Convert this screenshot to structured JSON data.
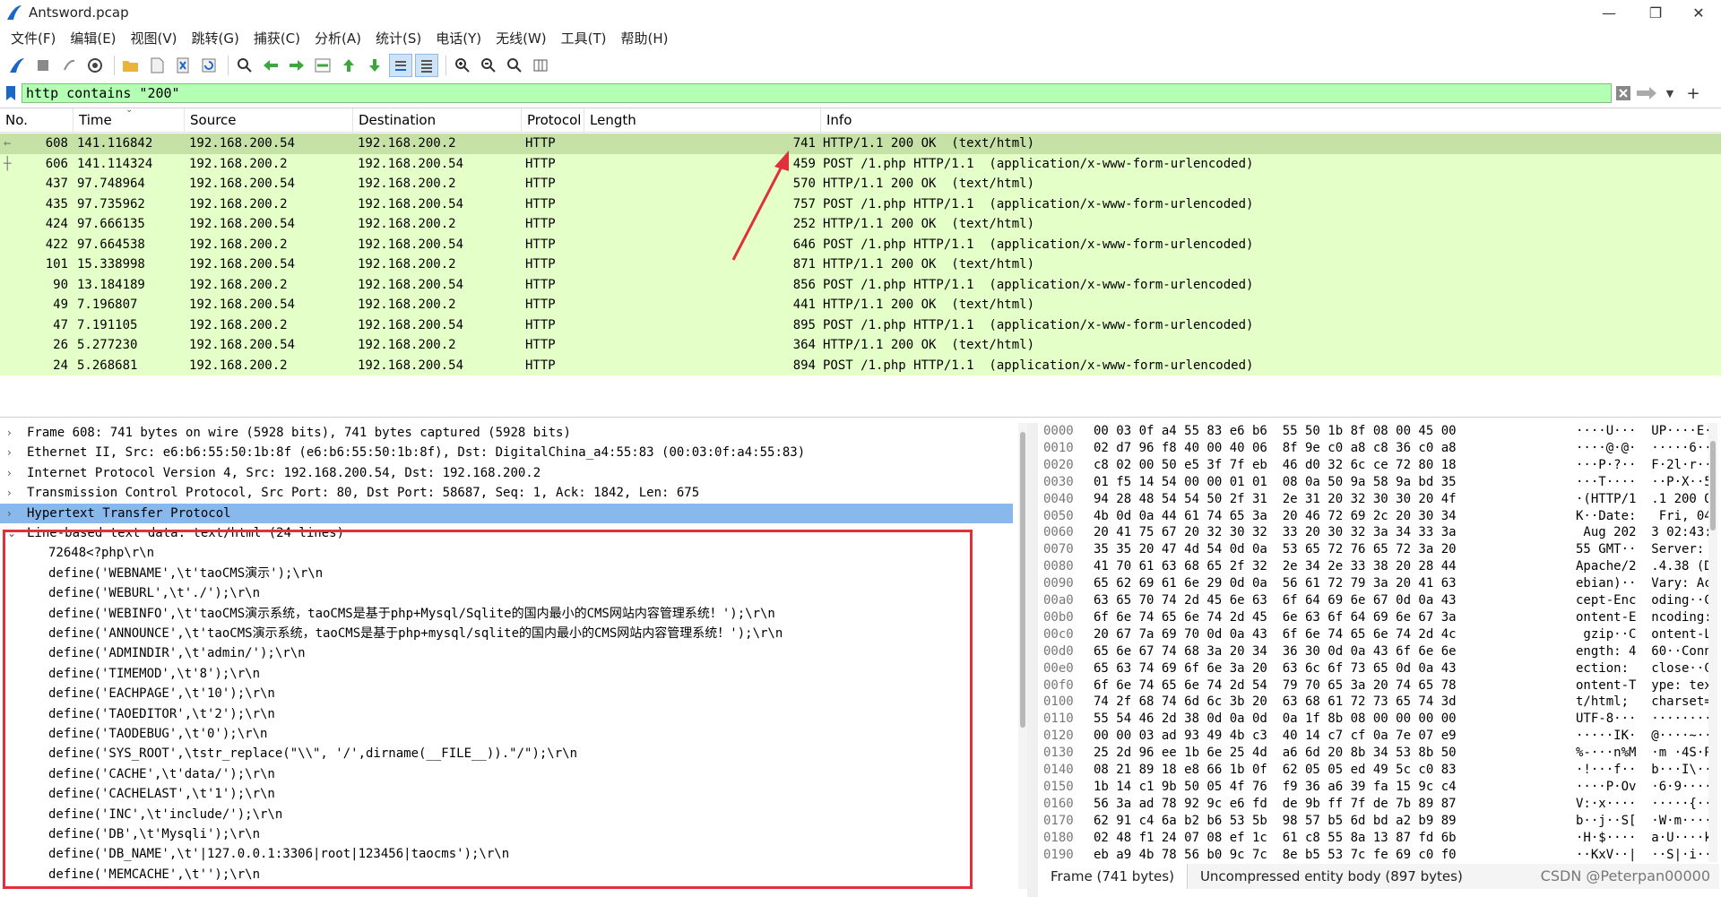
{
  "window": {
    "title": "Antsword.pcap"
  },
  "menu": [
    "文件(F)",
    "编辑(E)",
    "视图(V)",
    "跳转(G)",
    "捕获(C)",
    "分析(A)",
    "统计(S)",
    "电话(Y)",
    "无线(W)",
    "工具(T)",
    "帮助(H)"
  ],
  "toolbar": {
    "icons": [
      "shark-start-icon",
      "stop-icon",
      "restart-icon",
      "options-icon",
      "open-file-icon",
      "file-icon",
      "close-file-icon",
      "reload-icon",
      "find-icon",
      "go-back-icon",
      "go-forward-icon",
      "go-to-packet-icon",
      "first-packet-icon",
      "last-packet-icon",
      "autoscroll-icon",
      "colorize-icon",
      "zoom-in-icon",
      "zoom-out-icon",
      "zoom-reset-icon",
      "resize-columns-icon"
    ]
  },
  "filter": {
    "value": "http contains \"200\"",
    "bg_color": "#b3ffb3"
  },
  "packet_list": {
    "columns": [
      "No.",
      "Time",
      "Source",
      "Destination",
      "Protocol",
      "Length",
      "Info"
    ],
    "rows": [
      {
        "no": "608",
        "time": "141.116842",
        "src": "192.168.200.54",
        "dst": "192.168.200.2",
        "proto": "HTTP",
        "len": "741",
        "info": "HTTP/1.1 200 OK  (text/html)",
        "selected": true
      },
      {
        "no": "606",
        "time": "141.114324",
        "src": "192.168.200.2",
        "dst": "192.168.200.54",
        "proto": "HTTP",
        "len": "459",
        "info": "POST /1.php HTTP/1.1  (application/x-www-form-urlencoded)"
      },
      {
        "no": "437",
        "time": "97.748964",
        "src": "192.168.200.54",
        "dst": "192.168.200.2",
        "proto": "HTTP",
        "len": "570",
        "info": "HTTP/1.1 200 OK  (text/html)"
      },
      {
        "no": "435",
        "time": "97.735962",
        "src": "192.168.200.2",
        "dst": "192.168.200.54",
        "proto": "HTTP",
        "len": "757",
        "info": "POST /1.php HTTP/1.1  (application/x-www-form-urlencoded)"
      },
      {
        "no": "424",
        "time": "97.666135",
        "src": "192.168.200.54",
        "dst": "192.168.200.2",
        "proto": "HTTP",
        "len": "252",
        "info": "HTTP/1.1 200 OK  (text/html)"
      },
      {
        "no": "422",
        "time": "97.664538",
        "src": "192.168.200.2",
        "dst": "192.168.200.54",
        "proto": "HTTP",
        "len": "646",
        "info": "POST /1.php HTTP/1.1  (application/x-www-form-urlencoded)"
      },
      {
        "no": "101",
        "time": "15.338998",
        "src": "192.168.200.54",
        "dst": "192.168.200.2",
        "proto": "HTTP",
        "len": "871",
        "info": "HTTP/1.1 200 OK  (text/html)"
      },
      {
        "no": "90",
        "time": "13.184189",
        "src": "192.168.200.2",
        "dst": "192.168.200.54",
        "proto": "HTTP",
        "len": "856",
        "info": "POST /1.php HTTP/1.1  (application/x-www-form-urlencoded)"
      },
      {
        "no": "49",
        "time": "7.196807",
        "src": "192.168.200.54",
        "dst": "192.168.200.2",
        "proto": "HTTP",
        "len": "441",
        "info": "HTTP/1.1 200 OK  (text/html)"
      },
      {
        "no": "47",
        "time": "7.191105",
        "src": "192.168.200.2",
        "dst": "192.168.200.54",
        "proto": "HTTP",
        "len": "895",
        "info": "POST /1.php HTTP/1.1  (application/x-www-form-urlencoded)"
      },
      {
        "no": "26",
        "time": "5.277230",
        "src": "192.168.200.54",
        "dst": "192.168.200.2",
        "proto": "HTTP",
        "len": "364",
        "info": "HTTP/1.1 200 OK  (text/html)"
      },
      {
        "no": "24",
        "time": "5.268681",
        "src": "192.168.200.2",
        "dst": "192.168.200.54",
        "proto": "HTTP",
        "len": "894",
        "info": "POST /1.php HTTP/1.1  (application/x-www-form-urlencoded)"
      }
    ]
  },
  "details": {
    "tree": [
      {
        "text": "Frame 608: 741 bytes on wire (5928 bits), 741 bytes captured (5928 bits)",
        "expanded": false
      },
      {
        "text": "Ethernet II, Src: e6:b6:55:50:1b:8f (e6:b6:55:50:1b:8f), Dst: DigitalChina_a4:55:83 (00:03:0f:a4:55:83)",
        "expanded": false
      },
      {
        "text": "Internet Protocol Version 4, Src: 192.168.200.54, Dst: 192.168.200.2",
        "expanded": false
      },
      {
        "text": "Transmission Control Protocol, Src Port: 80, Dst Port: 58687, Seq: 1, Ack: 1842, Len: 675",
        "expanded": false
      },
      {
        "text": "Hypertext Transfer Protocol",
        "expanded": false,
        "highlight": true
      },
      {
        "text": "Line-based text data: text/html (24 lines)",
        "expanded": true
      }
    ],
    "body_lines": [
      "72648<?php\\r\\n",
      "define('WEBNAME',\\t'taoCMS演示');\\r\\n",
      "define('WEBURL',\\t'./');\\r\\n",
      "define('WEBINFO',\\t'taoCMS演示系统，taoCMS是基于php+Mysql/Sqlite的国内最小的CMS网站内容管理系统！');\\r\\n",
      "define('ANNOUNCE',\\t'taoCMS演示系统，taoCMS是基于php+mysql/sqlite的国内最小的CMS网站内容管理系统！');\\r\\n",
      "define('ADMINDIR',\\t'admin/');\\r\\n",
      "define('TIMEMOD',\\t'8');\\r\\n",
      "define('EACHPAGE',\\t'10');\\r\\n",
      "define('TAOEDITOR',\\t'2');\\r\\n",
      "define('TAODEBUG',\\t'0');\\r\\n",
      "define('SYS_ROOT',\\tstr_replace(\"\\\\\", '/',dirname(__FILE__)).\"/\");\\r\\n",
      "define('CACHE',\\t'data/');\\r\\n",
      "define('CACHELAST',\\t'1');\\r\\n",
      "define('INC',\\t'include/');\\r\\n",
      "define('DB',\\t'Mysqli');\\r\\n",
      "define('DB_NAME',\\t'|127.0.0.1:3306|root|123456|taocms');\\r\\n",
      "define('MEMCACHE',\\t'');\\r\\n"
    ]
  },
  "bytes": {
    "lines": [
      {
        "off": "0000",
        "hex": "00 03 0f a4 55 83 e6 b6  55 50 1b 8f 08 00 45 00",
        "ascii": "····U···  UP····E·"
      },
      {
        "off": "0010",
        "hex": "02 d7 96 f8 40 00 40 06  8f 9e c0 a8 c8 36 c0 a8",
        "ascii": "····@·@·  ·····6··"
      },
      {
        "off": "0020",
        "hex": "c8 02 00 50 e5 3f 7f eb  46 d0 32 6c ce 72 80 18",
        "ascii": "···P·?··  F·2l·r··"
      },
      {
        "off": "0030",
        "hex": "01 f5 14 54 00 00 01 01  08 0a 50 9a 58 9a bd 35",
        "ascii": "···T····  ··P·X··5"
      },
      {
        "off": "0040",
        "hex": "94 28 48 54 54 50 2f 31  2e 31 20 32 30 30 20 4f",
        "ascii": "·(HTTP/1  .1 200 O"
      },
      {
        "off": "0050",
        "hex": "4b 0d 0a 44 61 74 65 3a  20 46 72 69 2c 20 30 34",
        "ascii": "K··Date:   Fri, 04"
      },
      {
        "off": "0060",
        "hex": "20 41 75 67 20 32 30 32  33 20 30 32 3a 34 33 3a",
        "ascii": " Aug 202  3 02:43:"
      },
      {
        "off": "0070",
        "hex": "35 35 20 47 4d 54 0d 0a  53 65 72 76 65 72 3a 20",
        "ascii": "55 GMT··  Server: "
      },
      {
        "off": "0080",
        "hex": "41 70 61 63 68 65 2f 32  2e 34 2e 33 38 20 28 44",
        "ascii": "Apache/2  .4.38 (D"
      },
      {
        "off": "0090",
        "hex": "65 62 69 61 6e 29 0d 0a  56 61 72 79 3a 20 41 63",
        "ascii": "ebian)··  Vary: Ac"
      },
      {
        "off": "00a0",
        "hex": "63 65 70 74 2d 45 6e 63  6f 64 69 6e 67 0d 0a 43",
        "ascii": "cept-Enc  oding··C"
      },
      {
        "off": "00b0",
        "hex": "6f 6e 74 65 6e 74 2d 45  6e 63 6f 64 69 6e 67 3a",
        "ascii": "ontent-E  ncoding:"
      },
      {
        "off": "00c0",
        "hex": "20 67 7a 69 70 0d 0a 43  6f 6e 74 65 6e 74 2d 4c",
        "ascii": " gzip··C  ontent-L"
      },
      {
        "off": "00d0",
        "hex": "65 6e 67 74 68 3a 20 34  36 30 0d 0a 43 6f 6e 6e",
        "ascii": "ength: 4  60··Conn"
      },
      {
        "off": "00e0",
        "hex": "65 63 74 69 6f 6e 3a 20  63 6c 6f 73 65 0d 0a 43",
        "ascii": "ection:   close··C"
      },
      {
        "off": "00f0",
        "hex": "6f 6e 74 65 6e 74 2d 54  79 70 65 3a 20 74 65 78",
        "ascii": "ontent-T  ype: tex"
      },
      {
        "off": "0100",
        "hex": "74 2f 68 74 6d 6c 3b 20  63 68 61 72 73 65 74 3d",
        "ascii": "t/html;   charset="
      },
      {
        "off": "0110",
        "hex": "55 54 46 2d 38 0d 0a 0d  0a 1f 8b 08 00 00 00 00",
        "ascii": "UTF-8···  ········"
      },
      {
        "off": "0120",
        "hex": "00 00 03 ad 93 49 4b c3  40 14 c7 cf 0a 7e 07 e9",
        "ascii": "·····IK·  @····~··"
      },
      {
        "off": "0130",
        "hex": "25 2d 96 ee 1b 6e 25 4d  a6 6d 20 8b 34 53 8b 50",
        "ascii": "%-···n%M  ·m ·4S·P"
      },
      {
        "off": "0140",
        "hex": "08 21 89 18 e8 66 1b 0f  62 05 05 ed 49 5c c0 83",
        "ascii": "·!···f··  b···I\\··"
      },
      {
        "off": "0150",
        "hex": "1b 14 c1 9b 50 05 4f 76  f9 36 a6 39 fa 15 9c c4",
        "ascii": "····P·Ov  ·6·9····"
      },
      {
        "off": "0160",
        "hex": "56 3a ad 78 92 9c e6 fd  de 9b ff 7f de 7b 89 87",
        "ascii": "V:·x····  ·····{··"
      },
      {
        "off": "0170",
        "hex": "62 91 c4 6a b2 b6 53 5b  98 57 b5 6d bd a2 b9 89",
        "ascii": "b··j··S[  ·W·m····"
      },
      {
        "off": "0180",
        "hex": "02 48 f1 24 07 08 ef 1c  61 c8 55 8a 13 87 fd 6b",
        "ascii": "·H·$····  a·U····k"
      },
      {
        "off": "0190",
        "hex": "eb a9 4b 78 56 b0 9c 7c  8e b5 53 7c fe 69 c0 f0",
        "ascii": "··KxV··|  ··S|·i··"
      }
    ],
    "tabs": [
      "Frame (741 bytes)",
      "Uncompressed entity body (897 bytes)"
    ]
  },
  "watermark": "CSDN @Peterpan00000",
  "colors": {
    "row_bg": "#e4ffc7",
    "row_selected": "#c5e1a5",
    "tree_highlight": "#88b8ec",
    "annotation_red": "#e0303b"
  }
}
